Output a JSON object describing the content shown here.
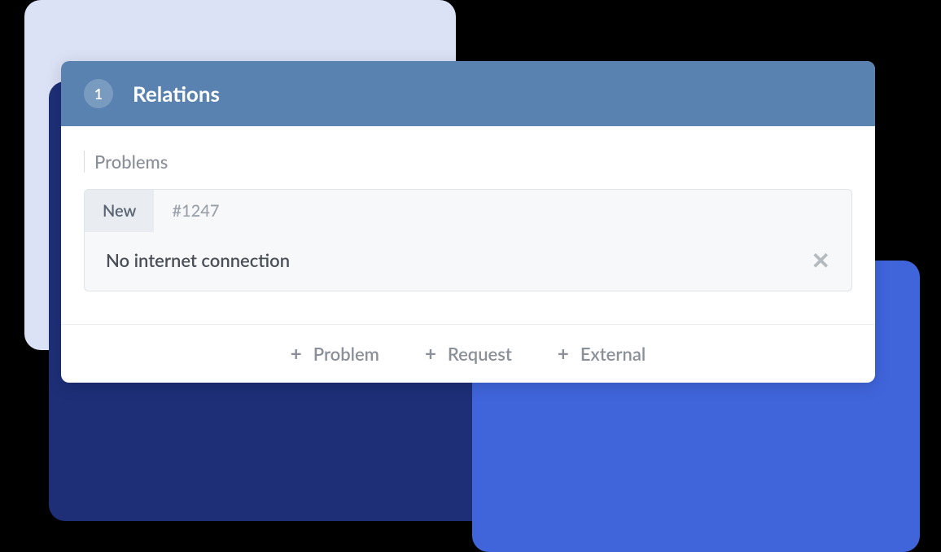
{
  "panel": {
    "count": "1",
    "title": "Relations",
    "section_label": "Problems",
    "item": {
      "status": "New",
      "id": "#1247",
      "title": "No internet connection"
    },
    "footer": {
      "problem": "Problem",
      "request": "Request",
      "external": "External"
    }
  }
}
